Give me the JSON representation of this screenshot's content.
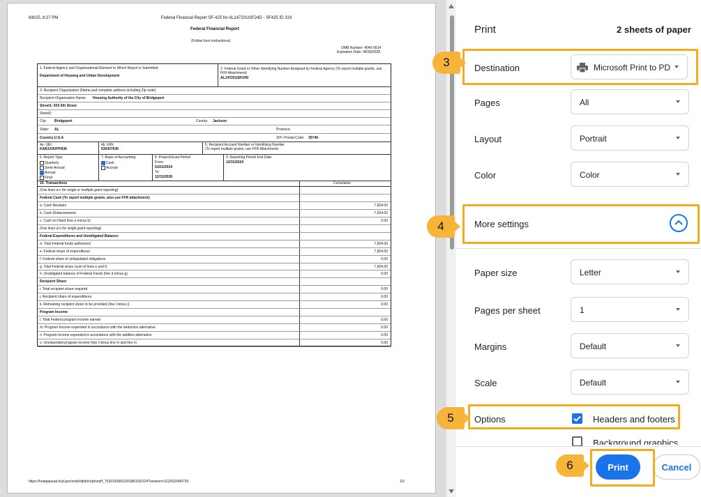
{
  "preview": {
    "header_left": "8/8/25, 8:27 PM",
    "header_center": "Federal Financial Report SF-425 for AL147201ISF24D - SF425 ID 319",
    "report_title": "Federal Financial Report",
    "follow_instructions": "(Follow form Instructions)",
    "omb_number": "OMB Number: 4040-0014",
    "expiration": "Expiration Date: 08/30/2028",
    "box1_label": "1. Federal Agency and Organizational Element to Which Report is Submitted",
    "box1_value": "Department of Housing and Urban Development",
    "box2_label": "2. Federal Grant or Other Identifying Number Assigned by Federal Agency (To report multiple grants, use FFR Attachment)",
    "box2_value": "AL147201ISF24D",
    "box3_label": "3. Recipient Organization (Name and complete address including Zip code)",
    "recipient_name_label": "Recipient Organization Name:",
    "recipient_name_value": "Housing Authority of the City of Bridgeport",
    "street1": "Street1: 603 6th Street",
    "street2": "Street2:",
    "city_label": "City:",
    "city_value": "Bridgeport",
    "county_label": "County:",
    "county_value": "Jackson",
    "state_label": "State:",
    "state_value": "AL",
    "province_label": "Province:",
    "country": "Country:U.S.A",
    "zip_label": "ZIP / Postal Code:",
    "zip_value": "35740-",
    "box4a_label": "4a. UEI:",
    "box4a_value": "KAB1X9UPFN36",
    "box4b_label": "4b. EIN:",
    "box4b_value": "630437636",
    "box5_label": "5. Recipient Account Number or Identifying Number",
    "box5_sub": "(To report multiple grants, use FFR Attachment)",
    "box6_label": "6. Report Type",
    "report_types": [
      "Quarterly",
      "Semi-Annual",
      "Annual",
      "Final"
    ],
    "box7_label": "7. Basis of Accounting",
    "accounting_types": [
      "Cash",
      "Accrual"
    ],
    "box8_label": "8. Project/Grant Period",
    "from_label": "From:",
    "from_value": "01/01/2024",
    "to_label": "To:",
    "to_value": "12/31/2028",
    "box9_label": "9. Reporting Period End Date",
    "box9_value": "12/31/2024",
    "transactions_label": "10. Transactions",
    "cumulative_label": "Cumulative",
    "rows": [
      {
        "label": "(Use lines a-c for single or multiple grant reporting)",
        "value": ""
      },
      {
        "label": "Federal Cash (To report multiple grants, also use FFR attachment):",
        "value": ""
      },
      {
        "label": "a. Cash Receipts",
        "value": "7,824.00"
      },
      {
        "label": "b. Cash Disbursements",
        "value": "7,824.00"
      },
      {
        "label": "c. Cash on Hand (line a minus b)",
        "value": "0.00"
      },
      {
        "label": "(Use lines d-o for single grant reporting)",
        "value": ""
      },
      {
        "label": "Federal Expenditures and Unobligated Balance:",
        "value": ""
      },
      {
        "label": "d. Total Federal funds authorized",
        "value": "7,824.00"
      },
      {
        "label": "e. Federal share of expenditures",
        "value": "7,824.00"
      },
      {
        "label": "f. Federal share of unliquidated obligations",
        "value": "0.00"
      },
      {
        "label": "g. Total Federal share (sum of lines e and f)",
        "value": "7,824.00"
      },
      {
        "label": "h. Unobligated balance of Federal Funds (line d minus g)",
        "value": "0.00"
      },
      {
        "label": "Recipient Share:",
        "value": ""
      },
      {
        "label": "i. Total recipient share required",
        "value": "0.00"
      },
      {
        "label": "j. Recipient share of expenditures",
        "value": "0.00"
      },
      {
        "label": "k. Remaining recipient share to be provided (line i minus j)",
        "value": "0.00"
      },
      {
        "label": "Program Income:",
        "value": ""
      },
      {
        "label": "l. Total Federal program income earned",
        "value": "0.00"
      },
      {
        "label": "m. Program Income expended in accordance with the deduction alternative",
        "value": "0.00"
      },
      {
        "label": "n. Program Income expended in accordance with the addition alternative",
        "value": "0.00"
      },
      {
        "label": "o. Unexpended program income (line l minus line m and line n)",
        "value": "0.00"
      }
    ],
    "footer_url": "https://hudappsuat.hud.gov/ords/ofpih/r/opfund/f_75201639811601861​60/224?session=1112522490739",
    "page_number": "1/2"
  },
  "print_panel": {
    "title": "Print",
    "sheets": "2 sheets of paper",
    "destination_label": "Destination",
    "destination_value": "Microsoft Print to PD",
    "pages_label": "Pages",
    "pages_value": "All",
    "layout_label": "Layout",
    "layout_value": "Portrait",
    "color_label": "Color",
    "color_value": "Color",
    "more_settings_label": "More settings",
    "paper_size_label": "Paper size",
    "paper_size_value": "Letter",
    "pages_per_sheet_label": "Pages per sheet",
    "pages_per_sheet_value": "1",
    "margins_label": "Margins",
    "margins_value": "Default",
    "scale_label": "Scale",
    "scale_value": "Default",
    "options_label": "Options",
    "headers_footers_label": "Headers and footers",
    "background_graphics_label": "Background graphics",
    "print_button": "Print",
    "cancel_button": "Cancel"
  },
  "callouts": [
    "3",
    "4",
    "5",
    "6"
  ],
  "colors": {
    "accent": "#1a73e8",
    "highlight": "#f4ab1e",
    "badge": "#f7b43a"
  }
}
